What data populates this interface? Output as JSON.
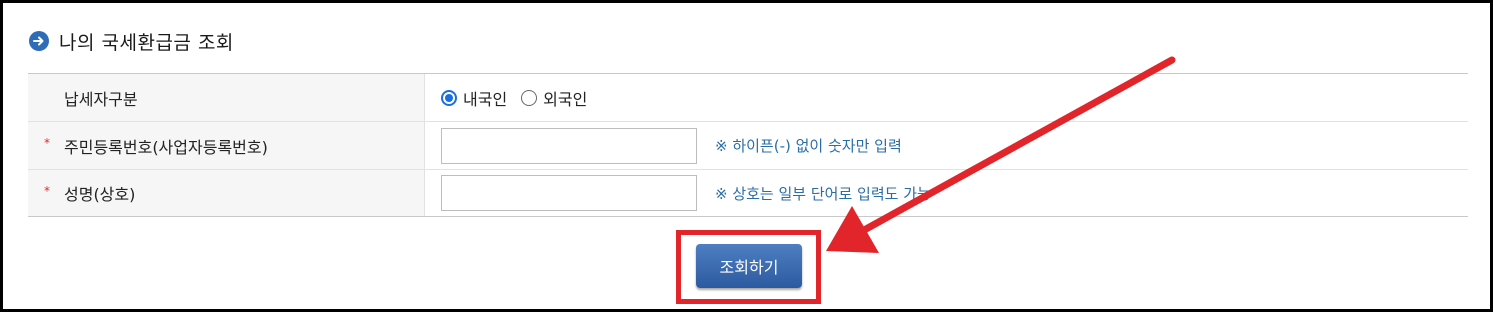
{
  "section": {
    "title": "나의 국세환급금 조회",
    "icon": "arrow-right-circle-icon"
  },
  "form": {
    "taxpayer_type": {
      "label": "납세자구분",
      "options": [
        {
          "label": "내국인",
          "selected": true
        },
        {
          "label": "외국인",
          "selected": false
        }
      ]
    },
    "resident_number": {
      "label": "주민등록번호(사업자등록번호)",
      "required": true,
      "value": "",
      "hint": "※ 하이픈(-) 없이 숫자만 입력"
    },
    "name": {
      "label": "성명(상호)",
      "required": true,
      "value": "",
      "hint": "※ 상호는 일부 단어로 입력도 가능"
    }
  },
  "submit": {
    "label": "조회하기"
  },
  "annotation": {
    "highlight_color": "#e1252a"
  },
  "colors": {
    "accent": "#2e6cb8",
    "hint": "#2a6ea8",
    "button": "#3a67ad",
    "required": "#d23030"
  }
}
